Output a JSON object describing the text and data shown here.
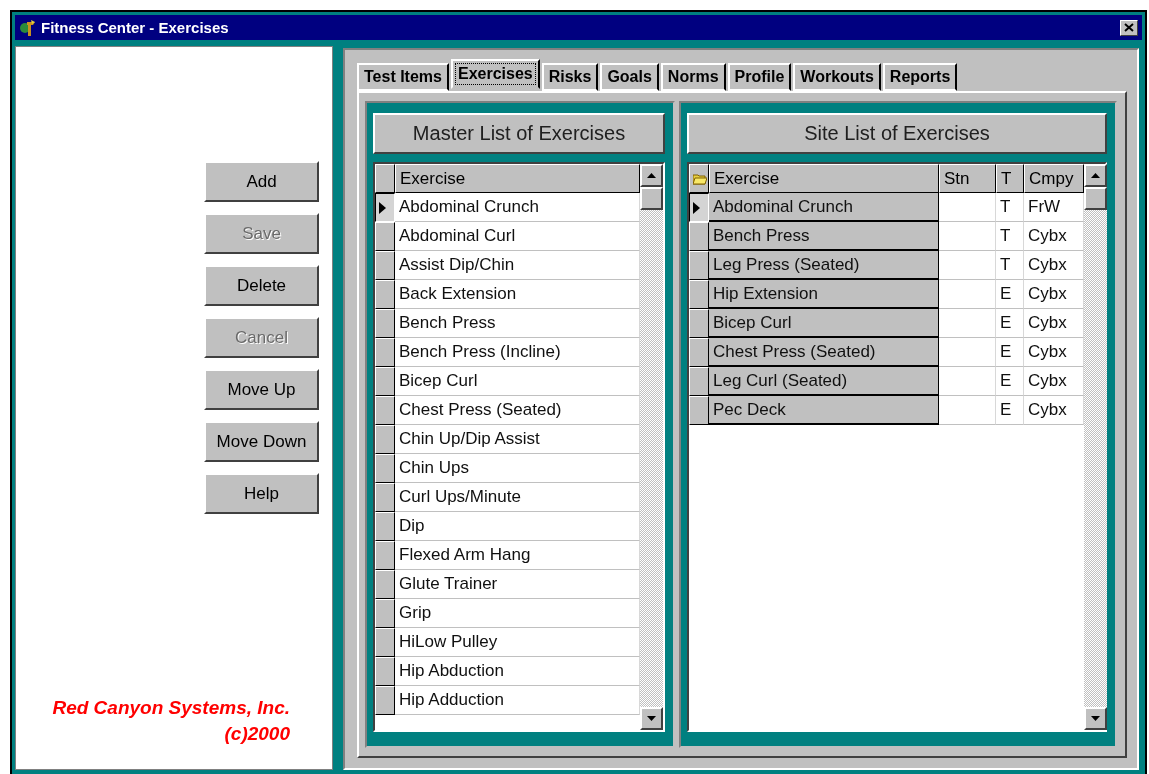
{
  "window": {
    "title": "Fitness Center - Exercises"
  },
  "tabs": [
    {
      "label": "Test Items",
      "selected": false
    },
    {
      "label": "Exercises",
      "selected": true
    },
    {
      "label": "Risks",
      "selected": false
    },
    {
      "label": "Goals",
      "selected": false
    },
    {
      "label": "Norms",
      "selected": false
    },
    {
      "label": "Profile",
      "selected": false
    },
    {
      "label": "Workouts",
      "selected": false
    },
    {
      "label": "Reports",
      "selected": false
    }
  ],
  "buttons": [
    {
      "label": "Add",
      "disabled": false
    },
    {
      "label": "Save",
      "disabled": true
    },
    {
      "label": "Delete",
      "disabled": false
    },
    {
      "label": "Cancel",
      "disabled": true
    },
    {
      "label": "Move Up",
      "disabled": false
    },
    {
      "label": "Move Down",
      "disabled": false
    },
    {
      "label": "Help",
      "disabled": false
    }
  ],
  "company": {
    "name": "Red Canyon Systems, Inc.",
    "copyright": "(c)2000"
  },
  "master_list": {
    "title": "Master List of Exercises",
    "column": "Exercise",
    "rows": [
      {
        "exercise": "Abdominal Crunch",
        "selected": true
      },
      {
        "exercise": "Abdominal Curl",
        "selected": false
      },
      {
        "exercise": "Assist Dip/Chin",
        "selected": false
      },
      {
        "exercise": "Back Extension",
        "selected": false
      },
      {
        "exercise": "Bench Press",
        "selected": false
      },
      {
        "exercise": "Bench Press (Incline)",
        "selected": false
      },
      {
        "exercise": "Bicep Curl",
        "selected": false
      },
      {
        "exercise": "Chest Press (Seated)",
        "selected": false
      },
      {
        "exercise": "Chin Up/Dip Assist",
        "selected": false
      },
      {
        "exercise": "Chin Ups",
        "selected": false
      },
      {
        "exercise": "Curl Ups/Minute",
        "selected": false
      },
      {
        "exercise": "Dip",
        "selected": false
      },
      {
        "exercise": "Flexed Arm Hang",
        "selected": false
      },
      {
        "exercise": "Glute Trainer",
        "selected": false
      },
      {
        "exercise": "Grip",
        "selected": false
      },
      {
        "exercise": "HiLow Pulley",
        "selected": false
      },
      {
        "exercise": "Hip Abduction",
        "selected": false
      },
      {
        "exercise": "Hip Adduction",
        "selected": false
      }
    ]
  },
  "site_list": {
    "title": "Site List of Exercises",
    "columns": [
      "Exercise",
      "Stn",
      "T",
      "Cmpy"
    ],
    "rows": [
      {
        "exercise": "Abdominal Crunch",
        "t": "T",
        "cmpy": "FrW",
        "selected": true
      },
      {
        "exercise": "Bench Press",
        "t": "T",
        "cmpy": "Cybx",
        "selected": false
      },
      {
        "exercise": "Leg Press (Seated)",
        "t": "T",
        "cmpy": "Cybx",
        "selected": false
      },
      {
        "exercise": "Hip Extension",
        "t": "E",
        "cmpy": "Cybx",
        "selected": false
      },
      {
        "exercise": "Bicep Curl",
        "t": "E",
        "cmpy": "Cybx",
        "selected": false
      },
      {
        "exercise": "Chest Press (Seated)",
        "t": "E",
        "cmpy": "Cybx",
        "selected": false
      },
      {
        "exercise": "Leg Curl (Seated)",
        "t": "E",
        "cmpy": "Cybx",
        "selected": false
      },
      {
        "exercise": "Pec Deck",
        "t": "E",
        "cmpy": "Cybx",
        "selected": false
      }
    ]
  }
}
